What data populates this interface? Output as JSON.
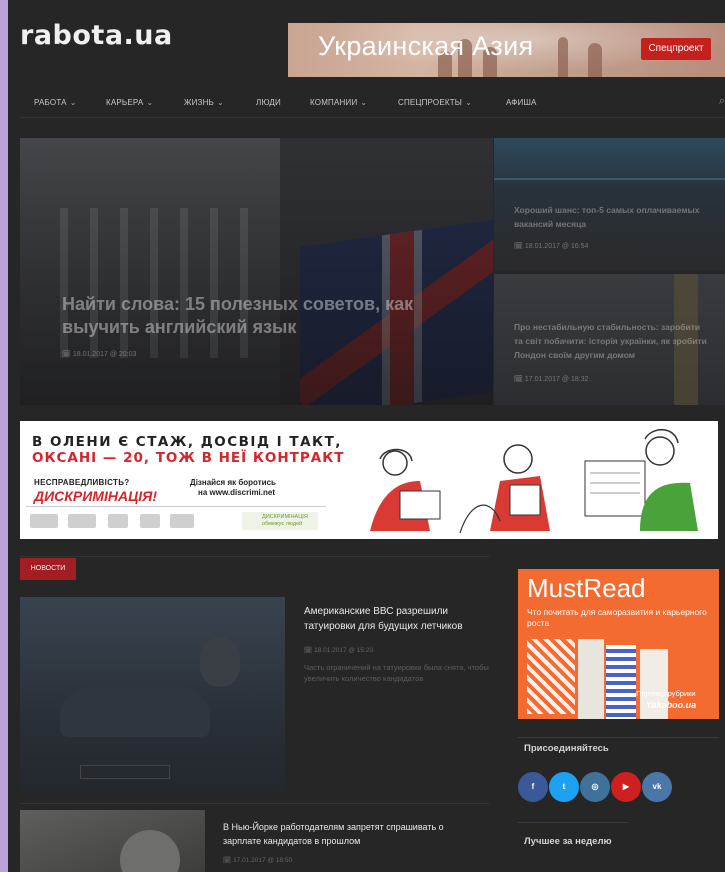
{
  "site": {
    "logo": "rabota.ua"
  },
  "promo": {
    "title": "Украинская Азия",
    "button": "Спецпроект"
  },
  "nav": {
    "items": [
      {
        "label": "РАБОТА",
        "dropdown": true
      },
      {
        "label": "КАРЬЕРА",
        "dropdown": true
      },
      {
        "label": "ЖИЗНЬ",
        "dropdown": true
      },
      {
        "label": "ЛЮДИ",
        "dropdown": false
      },
      {
        "label": "КОМПАНИИ",
        "dropdown": true
      },
      {
        "label": "СПЕЦПРОЕКТЫ",
        "dropdown": true
      },
      {
        "label": "АФИША",
        "dropdown": false
      }
    ],
    "chevron": "⌄",
    "search_icon": "⌕"
  },
  "hero": {
    "title": "Найти слова: 15 полезных советов, как выучить английский язык",
    "date": "18.01.2017 @ 20:03"
  },
  "side_cards": [
    {
      "title": "Хороший шанс: топ-5 самых оплачиваемых вакансий месяца",
      "date": "18.01.2017 @ 16:54"
    },
    {
      "title": "Про нестабильную стабильность: заробити та світ побачити: історія українки, як зробити Лондон своїм другим домом",
      "date": "17.01.2017 @ 18:32"
    }
  ],
  "banner": {
    "line1": "В ОЛЕНИ Є СТАЖ, ДОСВІД І ТАКТ,",
    "line2": "ОКСАНІ — 20, ТОЖ В НЕЇ КОНТРАКТ",
    "left_small": "НЕСПРАВЕДЛИВІСТЬ?",
    "left_big": "ДИСКРИМІНАЦІЯ!",
    "right_small": "Дізнайся як боротись",
    "right_url": "на www.discrimi.net",
    "partner": "ДИСКРИМІНАЦІЯ обмежує людей"
  },
  "news_section": {
    "badge": "НОВОСТИ"
  },
  "articles": [
    {
      "title": "Американские ВВС разрешили татуировки для будущих летчиков",
      "date": "18.01.2017 @ 15:20",
      "desc": "Часть ограничений на татуировки была снята, чтобы увеличить количество кандидатов"
    },
    {
      "title": "В Нью-Йорке работодателям запретят спрашивать о зарплате кандидатов в прошлом",
      "date": "17.01.2017 @ 18:50"
    }
  ],
  "mustread": {
    "title": "MustRead",
    "subtitle": "Что почитать для саморазвития и карьерного роста",
    "partner_label": "Партнер рубрики",
    "brand": "Yakaboo.ua"
  },
  "sidebar": {
    "join_title": "Присоединяйтесь",
    "social": [
      {
        "name": "facebook",
        "label": "f",
        "color": "#3b5998"
      },
      {
        "name": "twitter",
        "label": "t",
        "color": "#1da1f2"
      },
      {
        "name": "instagram",
        "label": "◎",
        "color": "#3f729b"
      },
      {
        "name": "youtube",
        "label": "▶",
        "color": "#cd201f"
      },
      {
        "name": "vk",
        "label": "vk",
        "color": "#4a76a8"
      }
    ],
    "best_week": "Лучшее за неделю"
  }
}
